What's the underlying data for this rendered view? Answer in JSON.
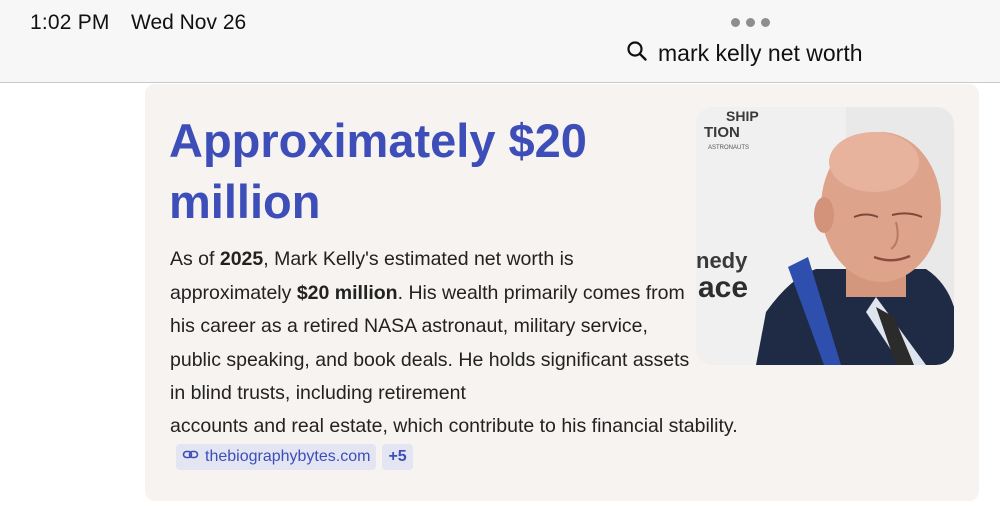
{
  "status_bar": {
    "time": "1:02 PM",
    "date": "Wed Nov 26"
  },
  "search": {
    "icon": "search-icon",
    "query": "mark kelly net worth"
  },
  "answer_card": {
    "title": "Approximately $20 million",
    "body": {
      "p1": "As of ",
      "b1": "2025",
      "p2": ", Mark Kelly's estimated net worth is approximately ",
      "b2": "$20 million",
      "p3": ". His wealth primarily comes from his career as a retired NASA astronaut, military service, public speaking, and book deals. He holds significant assets in blind trusts, including retirement",
      "last_line": "accounts and real estate, which contribute to his financial stability."
    },
    "image": {
      "backdrop_text_1": "SHIP",
      "backdrop_text_2": "TION",
      "backdrop_text_3": "ASTRONAUTS",
      "backdrop_text_4": "nedy",
      "backdrop_text_5": "ace"
    },
    "source": {
      "icon": "link-icon",
      "label": "thebiographybytes.com",
      "more": "+5"
    }
  },
  "colors": {
    "title": "#3d4eb8",
    "card_background": "#f6f3f1",
    "chip_background": "#e3e5f3"
  }
}
